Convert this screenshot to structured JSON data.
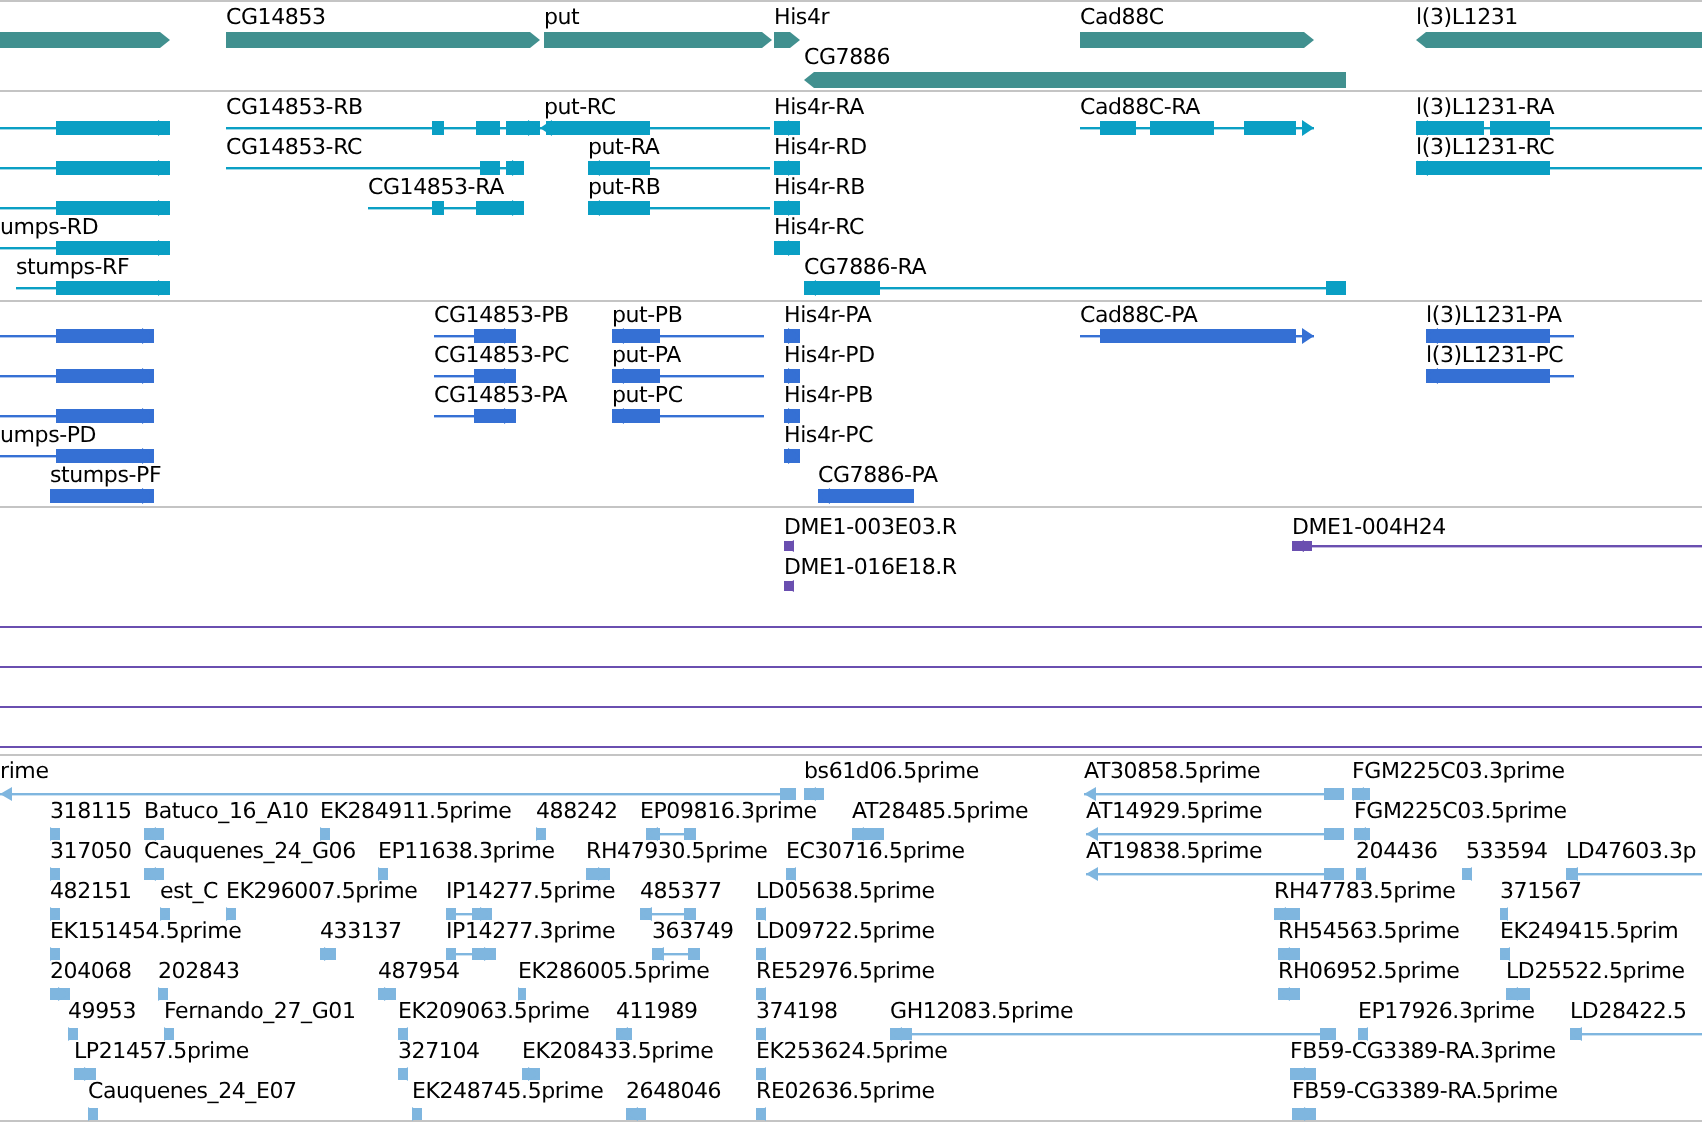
{
  "tracks": [
    {
      "kind": "gene",
      "features": [
        {
          "reverse": false
        },
        {
          "label": "CG14853",
          "reverse": false
        },
        {
          "label": "put",
          "reverse": false
        },
        {
          "label": "His4r",
          "reverse": false
        },
        {
          "label": "Cad88C",
          "reverse": false
        },
        {
          "label": "l(3)L1231",
          "reverse": true
        },
        {
          "label": "CG7886",
          "reverse": true
        }
      ]
    },
    {
      "kind": "transcript",
      "features": [
        {
          "reverse": false
        },
        {
          "label": "CG14853-RB",
          "reverse": false
        },
        {
          "label": "put-RC",
          "reverse": true
        },
        {
          "label": "His4r-RA",
          "reverse": false
        },
        {
          "label": "Cad88C-RA",
          "reverse": false
        },
        {
          "label": "l(3)L1231-RA",
          "reverse": true
        },
        {
          "reverse": false
        },
        {
          "label": "CG14853-RC",
          "reverse": false
        },
        {
          "label": "put-RA",
          "reverse": true
        },
        {
          "label": "His4r-RD",
          "reverse": false
        },
        {
          "label": "l(3)L1231-RC",
          "reverse": true
        },
        {
          "reverse": false
        },
        {
          "label": "CG14853-RA",
          "reverse": false
        },
        {
          "label": "put-RB",
          "reverse": true
        },
        {
          "label": "His4r-RB",
          "reverse": false
        },
        {
          "label": "umps-RD",
          "reverse": false
        },
        {
          "label": "His4r-RC",
          "reverse": false
        },
        {
          "label": "stumps-RF",
          "reverse": false
        },
        {
          "label": "CG7886-RA",
          "reverse": true
        }
      ]
    },
    {
      "kind": "protein",
      "features": [
        {
          "reverse": false
        },
        {
          "label": "CG14853-PB",
          "reverse": false
        },
        {
          "label": "put-PB",
          "reverse": true
        },
        {
          "label": "His4r-PA",
          "reverse": false
        },
        {
          "label": "Cad88C-PA",
          "reverse": false
        },
        {
          "label": "l(3)L1231-PA",
          "reverse": true
        },
        {
          "reverse": false
        },
        {
          "label": "CG14853-PC",
          "reverse": false
        },
        {
          "label": "put-PA",
          "reverse": true
        },
        {
          "label": "His4r-PD",
          "reverse": false
        },
        {
          "label": "l(3)L1231-PC",
          "reverse": true
        },
        {
          "reverse": false
        },
        {
          "label": "CG14853-PA",
          "reverse": false
        },
        {
          "label": "put-PC",
          "reverse": true
        },
        {
          "label": "His4r-PB",
          "reverse": false
        },
        {
          "label": "umps-PD",
          "reverse": false
        },
        {
          "label": "His4r-PC",
          "reverse": false
        },
        {
          "label": "stumps-PF",
          "reverse": false
        },
        {
          "label": "CG7886-PA",
          "reverse": true
        }
      ]
    },
    {
      "kind": "match",
      "features": [
        {
          "label": "DME1-003E03.R",
          "reverse": true
        },
        {
          "label": "DME1-004H24",
          "reverse": true
        },
        {
          "label": "DME1-016E18.R",
          "reverse": true
        }
      ]
    },
    {
      "kind": "est",
      "features": [
        {
          "label": "rime",
          "reverse": true
        },
        {
          "label": "bs61d06.5prime",
          "reverse": true
        },
        {
          "label": "AT30858.5prime",
          "reverse": true
        },
        {
          "label": "FGM225C03.3prime",
          "reverse": true
        },
        {
          "label": "318115",
          "reverse": false
        },
        {
          "label": "Batuco_16_A10",
          "reverse": true
        },
        {
          "label": "EK284911.5prime",
          "reverse": false
        },
        {
          "label": "488242",
          "reverse": false
        },
        {
          "label": "EP09816.3prime",
          "reverse": true
        },
        {
          "label": "AT28485.5prime",
          "reverse": true
        },
        {
          "label": "AT14929.5prime",
          "reverse": true
        },
        {
          "label": "FGM225C03.5prime",
          "reverse": true
        },
        {
          "label": "317050",
          "reverse": false
        },
        {
          "label": "Cauquenes_24_G06",
          "reverse": true
        },
        {
          "label": "EP11638.3prime",
          "reverse": false
        },
        {
          "label": "RH47930.5prime",
          "reverse": false
        },
        {
          "label": "EC30716.5prime",
          "reverse": true
        },
        {
          "label": "AT19838.5prime",
          "reverse": true
        },
        {
          "label": "204436",
          "reverse": true
        },
        {
          "label": "533594",
          "reverse": true
        },
        {
          "label": "LD47603.3p",
          "reverse": true
        },
        {
          "label": "482151",
          "reverse": false
        },
        {
          "label": "est_C",
          "reverse": false
        },
        {
          "label": "EK296007.5prime",
          "reverse": false
        },
        {
          "label": "IP14277.5prime",
          "reverse": false
        },
        {
          "label": "485377",
          "reverse": true
        },
        {
          "label": "LD05638.5prime",
          "reverse": true
        },
        {
          "label": "RH47783.5prime",
          "reverse": true
        },
        {
          "label": "371567",
          "reverse": true
        },
        {
          "label": "EK151454.5prime",
          "reverse": false
        },
        {
          "label": "433137",
          "reverse": false
        },
        {
          "label": "IP14277.3prime",
          "reverse": false
        },
        {
          "label": "363749",
          "reverse": true
        },
        {
          "label": "LD09722.5prime",
          "reverse": true
        },
        {
          "label": "RH54563.5prime",
          "reverse": true
        },
        {
          "label": "EK249415.5prim",
          "reverse": true
        },
        {
          "label": "204068",
          "reverse": false
        },
        {
          "label": "202843",
          "reverse": false
        },
        {
          "label": "487954",
          "reverse": false
        },
        {
          "label": "EK286005.5prime",
          "reverse": false
        },
        {
          "label": "RE52976.5prime",
          "reverse": true
        },
        {
          "label": "RH06952.5prime",
          "reverse": true
        },
        {
          "label": "LD25522.5prime",
          "reverse": true
        },
        {
          "label": "49953",
          "reverse": false
        },
        {
          "label": "Fernando_27_G01",
          "reverse": false
        },
        {
          "label": "EK209063.5prime",
          "reverse": true
        },
        {
          "label": "411989",
          "reverse": true
        },
        {
          "label": "374198",
          "reverse": true
        },
        {
          "label": "GH12083.5prime",
          "reverse": true
        },
        {
          "label": "EP17926.3prime",
          "reverse": true
        },
        {
          "label": "LD28422.5",
          "reverse": true
        },
        {
          "label": "LP21457.5prime",
          "reverse": false
        },
        {
          "label": "327104",
          "reverse": true
        },
        {
          "label": "EK208433.5prime",
          "reverse": false
        },
        {
          "label": "EK253624.5prime",
          "reverse": true
        },
        {
          "label": "FB59-CG3389-RA.3prime",
          "reverse": false
        },
        {
          "label": "Cauquenes_24_E07",
          "reverse": false
        },
        {
          "label": "EK248745.5prime",
          "reverse": false
        },
        {
          "label": "2648046",
          "reverse": true
        },
        {
          "label": "RE02636.5prime",
          "reverse": true
        },
        {
          "label": "FB59-CG3389-RA.5prime",
          "reverse": false
        }
      ]
    }
  ]
}
